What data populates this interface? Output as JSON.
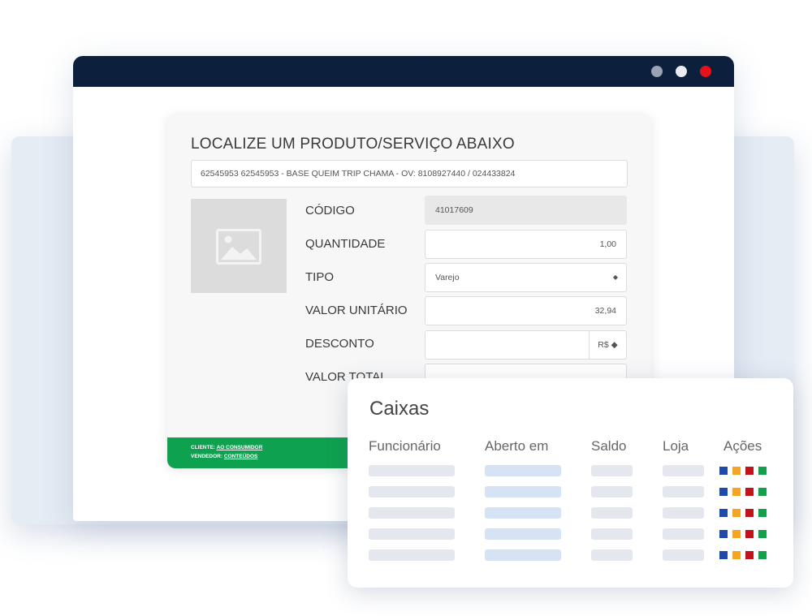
{
  "window": {
    "controls": [
      "minimize-dot",
      "maximize-dot",
      "close-dot"
    ]
  },
  "search_card": {
    "title": "LOCALIZE UM PRODUTO/SERVIÇO ABAIXO",
    "search_value": "62545953 62545953 - BASE QUEIM TRIP CHAMA - OV: 8108927440 / 024433824",
    "image_placeholder_icon": "image-icon",
    "fields": {
      "codigo_label": "CÓDIGO",
      "codigo_value": "41017609",
      "quantidade_label": "QUANTIDADE",
      "quantidade_value": "1,00",
      "tipo_label": "TIPO",
      "tipo_value": "Varejo",
      "valor_unitario_label": "VALOR UNITÁRIO",
      "valor_unitario_value": "32,94",
      "desconto_label": "DESCONTO",
      "desconto_value": "",
      "desconto_unit": "R$",
      "valor_total_label": "VALOR TOTAL"
    },
    "footer": {
      "cliente_prefix": "CLIENTE:",
      "cliente_value": "AO CONSUMIDOR",
      "vendedor_prefix": "VENDEDOR:",
      "vendedor_value": "CONTEÚDOS"
    }
  },
  "caixas": {
    "title": "Caixas",
    "columns": [
      "Funcionário",
      "Aberto em",
      "Saldo",
      "Loja",
      "Ações"
    ],
    "row_count_visible": 5,
    "action_colors": [
      "#1f4aa8",
      "#f4a623",
      "#c0141b",
      "#13a04a"
    ]
  },
  "colors": {
    "titlebar": "#0c1f3d",
    "close": "#e3121b",
    "footer_green": "#0ea14f"
  }
}
